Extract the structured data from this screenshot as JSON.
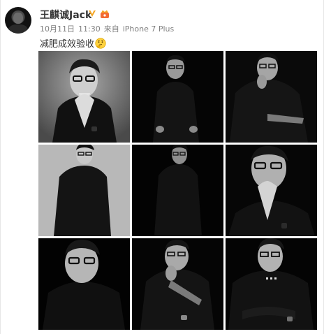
{
  "post": {
    "username": "王麒诚Jack",
    "verified_icon": "v-verified-icon",
    "member_icon": "vip-member-icon",
    "date": "10月11日",
    "time": "11:30",
    "source_prefix": "来自",
    "device": "iPhone 7 Plus",
    "text": "减肥成效验收",
    "emoji": "thinking-face-emoji"
  },
  "photos": [
    {
      "name": "photo-1",
      "bg": "#8c8c8c",
      "pose": "hands-prayer"
    },
    {
      "name": "photo-2",
      "bg": "#050505",
      "pose": "seated"
    },
    {
      "name": "photo-3",
      "bg": "#0a0a0a",
      "pose": "chin-hand"
    },
    {
      "name": "photo-4",
      "bg": "#b8b8b8",
      "pose": "standing"
    },
    {
      "name": "photo-5",
      "bg": "#030303",
      "pose": "standing-dark"
    },
    {
      "name": "photo-6",
      "bg": "#060606",
      "pose": "hands-prayer-close"
    },
    {
      "name": "photo-7",
      "bg": "#020202",
      "pose": "closeup"
    },
    {
      "name": "photo-8",
      "bg": "#050505",
      "pose": "chin-hand-wide"
    },
    {
      "name": "photo-9",
      "bg": "#040404",
      "pose": "arms-crossed"
    }
  ]
}
